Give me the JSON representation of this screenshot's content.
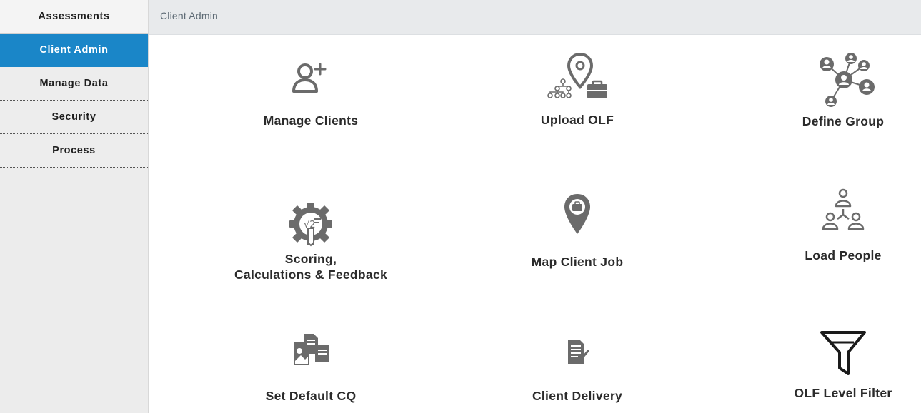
{
  "sidebar": {
    "items": [
      {
        "label": "Assessments",
        "active": false
      },
      {
        "label": "Client Admin",
        "active": true
      },
      {
        "label": "Manage Data",
        "active": false
      },
      {
        "label": "Security",
        "active": false
      },
      {
        "label": "Process",
        "active": false
      }
    ]
  },
  "header": {
    "breadcrumb": "Client Admin"
  },
  "tiles": [
    {
      "label": "Manage Clients",
      "icon": "add-user-icon"
    },
    {
      "label": "Upload OLF",
      "icon": "org-location-upload-icon"
    },
    {
      "label": "Define Group",
      "icon": "network-group-icon"
    },
    {
      "label": "Scoring,\nCalculations & Feedback",
      "icon": "gear-calculation-icon"
    },
    {
      "label": "Map Client Job",
      "icon": "map-pin-briefcase-icon"
    },
    {
      "label": "Load People",
      "icon": "people-hierarchy-icon"
    },
    {
      "label": "Set Default CQ",
      "icon": "documents-stack-icon"
    },
    {
      "label": "Client Delivery",
      "icon": "document-edit-icon"
    },
    {
      "label": "OLF Level Filter",
      "icon": "filter-funnel-icon"
    }
  ],
  "colors": {
    "accent": "#1a86c8",
    "icon": "#6b6b6b"
  }
}
